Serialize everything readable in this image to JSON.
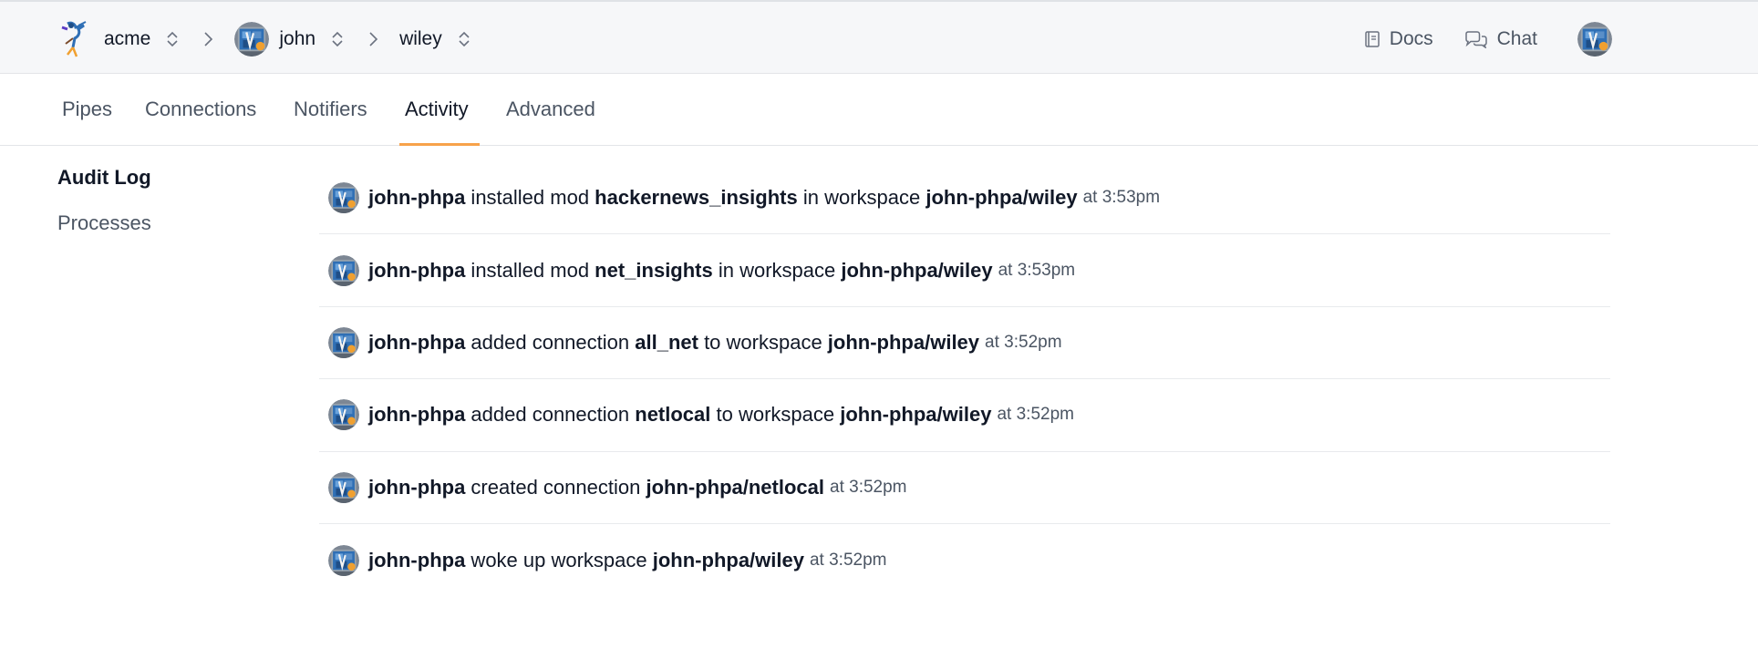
{
  "header": {
    "org": "acme",
    "user": "john",
    "workspace": "wiley",
    "docs_label": "Docs",
    "chat_label": "Chat"
  },
  "tabs": [
    {
      "label": "Pipes",
      "active": false
    },
    {
      "label": "Connections",
      "active": false
    },
    {
      "label": "Notifiers",
      "active": false
    },
    {
      "label": "Activity",
      "active": true
    },
    {
      "label": "Advanced",
      "active": false
    }
  ],
  "sidebar": {
    "items": [
      {
        "label": "Audit Log",
        "active": true
      },
      {
        "label": "Processes",
        "active": false
      }
    ]
  },
  "activity": [
    {
      "actor": "john-phpa",
      "verb": " installed mod ",
      "object": "hackernews_insights",
      "prep": " in workspace ",
      "target": "john-phpa/wiley",
      "time": "at 3:53pm"
    },
    {
      "actor": "john-phpa",
      "verb": " installed mod ",
      "object": "net_insights",
      "prep": " in workspace ",
      "target": "john-phpa/wiley",
      "time": "at 3:53pm"
    },
    {
      "actor": "john-phpa",
      "verb": " added connection ",
      "object": "all_net",
      "prep": " to workspace ",
      "target": "john-phpa/wiley",
      "time": "at 3:52pm"
    },
    {
      "actor": "john-phpa",
      "verb": " added connection ",
      "object": "netlocal",
      "prep": " to workspace ",
      "target": "john-phpa/wiley",
      "time": "at 3:52pm"
    },
    {
      "actor": "john-phpa",
      "verb": " created connection ",
      "object": "john-phpa/netlocal",
      "prep": "",
      "target": "",
      "time": "at 3:52pm"
    },
    {
      "actor": "john-phpa",
      "verb": " woke up workspace ",
      "object": "john-phpa/wiley",
      "prep": "",
      "target": "",
      "time": "at 3:52pm"
    }
  ],
  "colors": {
    "accent": "#f7a24a",
    "avatar_blue": "#2f6fb5",
    "avatar_orange": "#f0a030"
  }
}
